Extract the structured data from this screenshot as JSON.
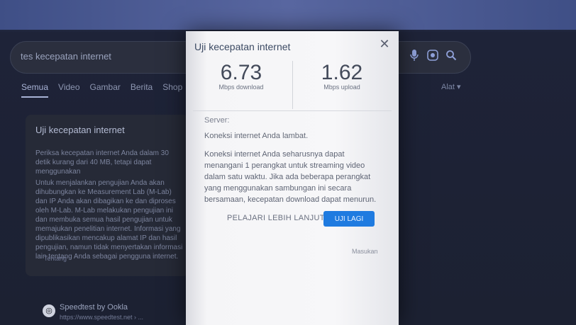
{
  "background": {
    "search_query": "tes kecepatan internet",
    "tabs": [
      "Semua",
      "Video",
      "Gambar",
      "Berita",
      "Shop"
    ],
    "tools_label": "Alat",
    "card": {
      "title": "Uji kecepatan internet",
      "text1": "Periksa kecepatan internet Anda dalam 30 detik kurang dari 40 MB, tetapi dapat menggunakan",
      "text2": "Untuk menjalankan pengujian Anda akan dihubungkan ke Measurement Lab (M-Lab) dan IP Anda akan dibagikan ke dan diproses oleh M-Lab. M-Lab melakukan pengujian ini dan membuka semua hasil pengujian untuk memajukan penelitian internet. Informasi yang dipublikasikan mencakup alamat IP dan hasil pengujian, namun tidak menyertakan informasi lain tentang Anda sebagai pengguna internet.",
      "footer": "Tentang"
    },
    "result": {
      "title": "Speedtest by Ookla",
      "url": "https://www.speedtest.net › ..."
    },
    "icons": {
      "mic": "microphone-icon",
      "lens": "lens-icon",
      "search": "search-icon"
    }
  },
  "dialog": {
    "title": "Uji kecepatan internet",
    "download_value": "6.73",
    "download_unit": "Mbps download",
    "upload_value": "1.62",
    "upload_unit": "Mbps upload",
    "server_label": "Server:",
    "status": "Koneksi internet Anda lambat.",
    "description": "Koneksi internet Anda seharusnya dapat menangani 1 perangkat untuk streaming video dalam satu waktu. Jika ada beberapa perangkat yang menggunakan sambungan ini secara bersamaan, kecepatan download dapat menurun.",
    "learn_more": "PELAJARI LEBIH LANJUT",
    "retry": "UJI LAGI",
    "feedback": "Masukan",
    "accent_color": "#1f7be0"
  }
}
